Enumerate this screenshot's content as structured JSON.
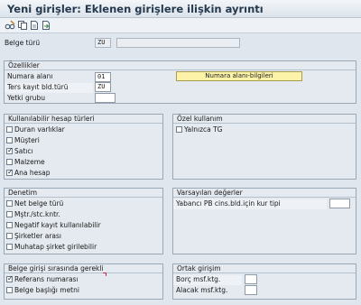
{
  "header": {
    "title": "Yeni girişler: Eklenen girişlere ilişkin ayrıntı"
  },
  "toolbar": {
    "icons": [
      "glasses-edit-icon",
      "copy-icon",
      "document-icon",
      "export-icon"
    ]
  },
  "doc_type": {
    "label": "Belge türü",
    "value": "ZU",
    "description": ""
  },
  "ozellikler": {
    "title": "Özellikler",
    "fields": [
      {
        "label": "Numara alanı",
        "value": "01"
      },
      {
        "label": "Ters kayıt bld.türü",
        "value": "ZU"
      },
      {
        "label": "Yetki grubu",
        "value": ""
      }
    ],
    "button_label": "Numara alanı-bilgileri"
  },
  "hesap_turleri": {
    "title": "Kullanılabilir hesap türleri",
    "items": [
      {
        "label": "Duran varlıklar",
        "checked": false
      },
      {
        "label": "Müşteri",
        "checked": false
      },
      {
        "label": "Satıcı",
        "checked": true
      },
      {
        "label": "Malzeme",
        "checked": false
      },
      {
        "label": "Ana hesap",
        "checked": true
      }
    ]
  },
  "ozel_kullanim": {
    "title": "Özel kullanım",
    "items": [
      {
        "label": "Yalnızca TG",
        "checked": false
      }
    ]
  },
  "denetim": {
    "title": "Denetim",
    "items": [
      {
        "label": "Net belge türü",
        "checked": false
      },
      {
        "label": "Mştr./stc.kntr.",
        "checked": false
      },
      {
        "label": "Negatif kayıt kullanılabilir",
        "checked": false
      },
      {
        "label": "Şirketler arası",
        "checked": false
      },
      {
        "label": "Muhatap şirket girilebilir",
        "checked": false
      }
    ]
  },
  "varsayilan": {
    "title": "Varsayılan değerler",
    "field_label": "Yabancı PB cins.bld.için kur tipi",
    "field_value": ""
  },
  "belge_girisi": {
    "title": "Belge girişi sırasında gerekli",
    "items": [
      {
        "label": "Referans numarası",
        "checked": true
      },
      {
        "label": "Belge başlığı metni",
        "checked": false
      }
    ]
  },
  "ortak_girisim": {
    "title": "Ortak girişim",
    "fields": [
      {
        "label": "Borç msf.ktg.",
        "value": ""
      },
      {
        "label": "Alacak msf.ktg.",
        "value": ""
      }
    ]
  },
  "colors": {
    "button_yellow": "#fdf3a8",
    "title_text": "#25384d",
    "group_bg": "#e4eaf0"
  }
}
